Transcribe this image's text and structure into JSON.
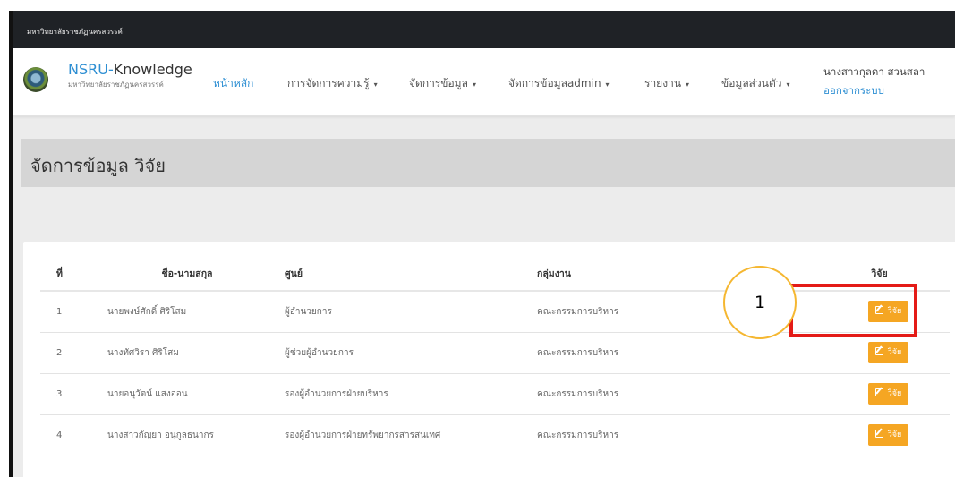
{
  "top_strip": {
    "university": "มหาวิทยาลัยราชภัฏนครสวรรค์"
  },
  "brand": {
    "name_prefix": "NSRU-",
    "name_rest": "Knowledge",
    "subtitle": "มหาวิทยาลัยราชภัฏนครสวรรค์"
  },
  "nav": {
    "items": [
      {
        "label": "หน้าหลัก",
        "dropdown": false,
        "active": true
      },
      {
        "label": "การจัดการความรู้",
        "dropdown": true
      },
      {
        "label": "จัดการข้อมูล",
        "dropdown": true
      },
      {
        "label": "จัดการข้อมูลadmin",
        "dropdown": true
      },
      {
        "label": "รายงาน",
        "dropdown": true
      },
      {
        "label": "ข้อมูลส่วนตัว",
        "dropdown": true
      }
    ],
    "caret": "▾"
  },
  "user": {
    "name": "นางสาวกุลดา สวนสลา",
    "logout": "ออกจากระบบ"
  },
  "page": {
    "title": "จัดการข้อมูล วิจัย"
  },
  "table": {
    "headers": {
      "no": "ที่",
      "name": "ชื่อ-นามสกุล",
      "center": "ศูนย์",
      "group": "กลุ่มงาน",
      "research": "วิจัย"
    },
    "rows": [
      {
        "no": "1",
        "name": "นายพงษ์ศักดิ์ ศิริโสม",
        "center": "ผู้อำนวยการ",
        "group": "คณะกรรมการบริหาร",
        "button": "วิจัย"
      },
      {
        "no": "2",
        "name": "นางทัศวิรา ศิริโสม",
        "center": "ผู้ช่วยผู้อำนวยการ",
        "group": "คณะกรรมการบริหาร",
        "button": "วิจัย"
      },
      {
        "no": "3",
        "name": "นายอนุวัตน์ แสงอ่อน",
        "center": "รองผู้อำนวยการฝ่ายบริหาร",
        "group": "คณะกรรมการบริหาร",
        "button": "วิจัย"
      },
      {
        "no": "4",
        "name": "นางสาวกัญยา อนุกูลธนากร",
        "center": "รองผู้อำนวยการฝ่ายทรัพยากรสารสนเทศ",
        "group": "คณะกรรมการบริหาร",
        "button": "วิจัย"
      }
    ]
  },
  "annotation": {
    "step": "1",
    "box_color": "#e41b17",
    "circle_color": "#f5b731"
  },
  "colors": {
    "accent": "#2e8fd3",
    "button": "#f5a623",
    "topbar": "#1f2226"
  }
}
